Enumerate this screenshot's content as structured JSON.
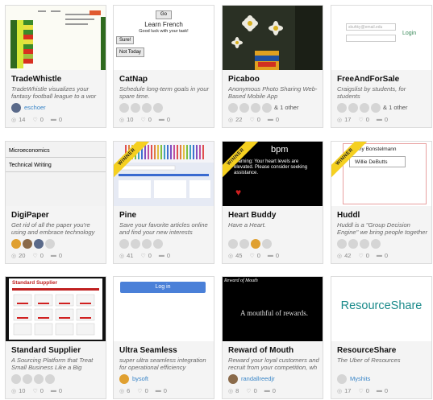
{
  "cards": [
    {
      "title": "TradeWhistle",
      "desc": "TradeWhistle visualizes your fantasy football league to a wor",
      "member": "eschoer",
      "other": "",
      "stats": [
        "14",
        "0",
        "0"
      ]
    },
    {
      "title": "CatNap",
      "desc": "Schedule long-term goals in your spare time.",
      "member": "",
      "other": "",
      "stats": [
        "10",
        "0",
        "0"
      ],
      "thumb": {
        "go": "Go",
        "heading": "Learn French",
        "sub": "Good luck with your task!",
        "sure": "Sure!",
        "not_today": "Not Today"
      }
    },
    {
      "title": "Picaboo",
      "desc": "Anonymous Photo Sharing Web-Based Mobile App",
      "member": "",
      "other": "& 1 other",
      "stats": [
        "22",
        "0",
        "0"
      ]
    },
    {
      "title": "FreeAndForSale",
      "desc": "Craigslist by students, for students",
      "member": "",
      "other": "& 1 other",
      "stats": [
        "17",
        "0",
        "0"
      ],
      "thumb": {
        "placeholder": "skuhky@email.edu",
        "login": "Login"
      }
    },
    {
      "title": "DigiPaper",
      "desc": "Get rid of all the paper you're using and embrace technology",
      "member": "",
      "other": "",
      "stats": [
        "20",
        "0",
        "0"
      ],
      "thumb": {
        "row1": "Microeconomics",
        "row2": "Technical Writing"
      }
    },
    {
      "title": "Pine",
      "desc": "Save your favorite articles online and find your new interests",
      "member": "",
      "other": "",
      "stats": [
        "41",
        "0",
        "0"
      ],
      "winner": "WINNER"
    },
    {
      "title": "Heart Buddy",
      "desc": "Have a Heart.",
      "member": "",
      "other": "",
      "stats": [
        "45",
        "0",
        "0"
      ],
      "winner": "WINNER",
      "thumb": {
        "bpm": "bpm",
        "warning": "Warning: Your heart levels are elevated. Please consider seeking assistance."
      }
    },
    {
      "title": "Huddl",
      "desc": "Huddl is a \"Group Decision Engine\" we bring people together",
      "member": "",
      "other": "",
      "stats": [
        "42",
        "0",
        "0"
      ],
      "winner": "WINNER",
      "thumb": {
        "name1": "Danny Bonstelmann",
        "name2": "Willie DeButts"
      }
    },
    {
      "title": "Standard Supplier",
      "desc": "A Sourcing Platform that Treat Small Business Like a Big",
      "member": "",
      "other": "",
      "stats": [
        "10",
        "0",
        "0"
      ],
      "thumb": {
        "brand": "Standard Supplier"
      }
    },
    {
      "title": "Ultra Seamless",
      "desc": "super ultra seamless integration for operational efficiency",
      "member": "bysoft",
      "other": "",
      "stats": [
        "6",
        "0",
        "0"
      ],
      "thumb": {
        "login": "Log in"
      }
    },
    {
      "title": "Reward of Mouth",
      "desc": "Reward your loyal customers and recruit from your competition, wh",
      "member": "randallreedjr",
      "other": "",
      "stats": [
        "8",
        "0",
        "0"
      ],
      "thumb": {
        "brand": "Reward of Mouth",
        "tagline": "A mouthful of rewards."
      }
    },
    {
      "title": "ResourceShare",
      "desc": "The Uber of Resources",
      "member": "Myshits",
      "other": "",
      "stats": [
        "17",
        "0",
        "0"
      ],
      "thumb": {
        "logo": "ResourceShare"
      }
    }
  ],
  "icons": {
    "views": "eye-icon",
    "likes": "heart-icon",
    "comments": "comment-icon"
  }
}
